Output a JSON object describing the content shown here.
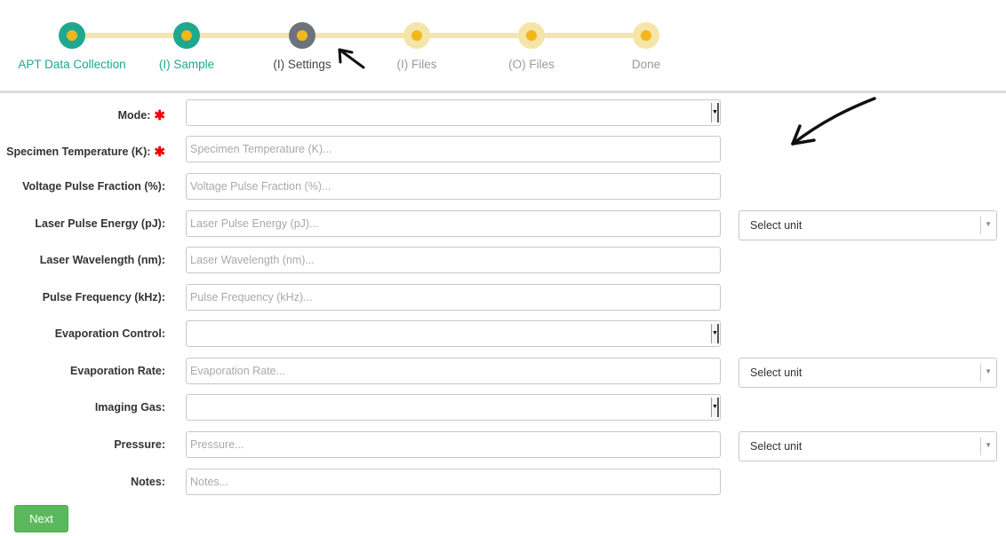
{
  "wizard": {
    "steps": [
      {
        "label": "APT Data Collection",
        "state": "done"
      },
      {
        "label": "(I) Sample",
        "state": "done"
      },
      {
        "label": "(I) Settings",
        "state": "active"
      },
      {
        "label": "(I) Files",
        "state": "todo"
      },
      {
        "label": "(O) Files",
        "state": "todo"
      },
      {
        "label": "Done",
        "state": "todo"
      }
    ]
  },
  "form": {
    "mode": {
      "label": "Mode:",
      "required": true,
      "value": ""
    },
    "specimen_temperature": {
      "label": "Specimen Temperature (K):",
      "required": true,
      "placeholder": "Specimen Temperature (K)..."
    },
    "voltage_pulse_fraction": {
      "label": "Voltage Pulse Fraction (%):",
      "placeholder": "Voltage Pulse Fraction (%)..."
    },
    "laser_pulse_energy": {
      "label": "Laser Pulse Energy (pJ):",
      "placeholder": "Laser Pulse Energy (pJ)...",
      "unit": "Select unit"
    },
    "laser_wavelength": {
      "label": "Laser Wavelength (nm):",
      "placeholder": "Laser Wavelength (nm)..."
    },
    "pulse_frequency": {
      "label": "Pulse Frequency (kHz):",
      "placeholder": "Pulse Frequency (kHz)..."
    },
    "evaporation_control": {
      "label": "Evaporation Control:",
      "value": ""
    },
    "evaporation_rate": {
      "label": "Evaporation Rate:",
      "placeholder": "Evaporation Rate...",
      "unit": "Select unit"
    },
    "imaging_gas": {
      "label": "Imaging Gas:",
      "value": ""
    },
    "pressure": {
      "label": "Pressure:",
      "placeholder": "Pressure...",
      "unit": "Select unit"
    },
    "notes": {
      "label": "Notes:",
      "placeholder": "Notes..."
    }
  },
  "buttons": {
    "next": "Next"
  },
  "colors": {
    "done": "#1fa88e",
    "active": "#6d737d",
    "todo": "#f6e5a8",
    "dot_center": "#f2b71b",
    "next": "#5cb85c",
    "required": "#ee0000"
  }
}
